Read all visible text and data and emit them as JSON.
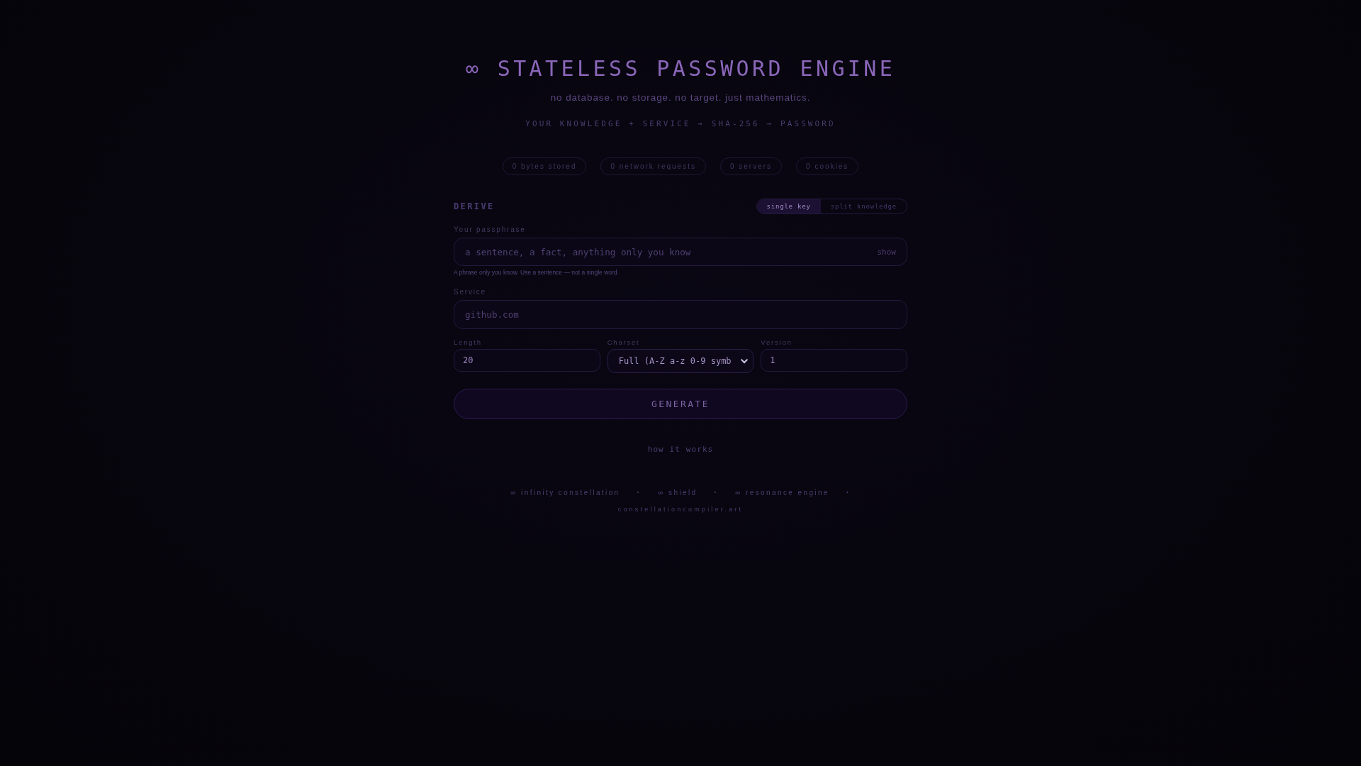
{
  "header": {
    "title": "∞ STATELESS PASSWORD ENGINE",
    "tagline": "no database. no storage. no target. just mathematics.",
    "formula": "YOUR KNOWLEDGE + SERVICE → SHA-256 → PASSWORD"
  },
  "stats": [
    "0 bytes stored",
    "0 network requests",
    "0 servers",
    "0 cookies"
  ],
  "derive": {
    "heading": "DERIVE",
    "modes": [
      {
        "label": "single key",
        "selected": true
      },
      {
        "label": "split knowledge",
        "selected": false
      }
    ],
    "passphrase": {
      "label": "Your passphrase",
      "placeholder": "a sentence, a fact, anything only you know",
      "toggle": "show",
      "hint": "A phrase only you know. Use a sentence — not a single word."
    },
    "service": {
      "label": "Service",
      "placeholder": "github.com"
    },
    "options": [
      {
        "kind": "input",
        "label": "Length",
        "value": "20"
      },
      {
        "kind": "select",
        "label": "Charset",
        "value": "Full (A-Z a-z 0-9 symb"
      },
      {
        "kind": "input",
        "label": "Version",
        "value": "1"
      }
    ],
    "generate": "GENERATE",
    "help_link": "how it works"
  },
  "footer": {
    "links": [
      {
        "label": "∞ infinity constellation",
        "separator": "·"
      },
      {
        "label": "∞ shield",
        "separator": "·"
      },
      {
        "label": "∞ resonance engine",
        "separator": "·"
      }
    ],
    "site": "constellationcompiler.art"
  }
}
